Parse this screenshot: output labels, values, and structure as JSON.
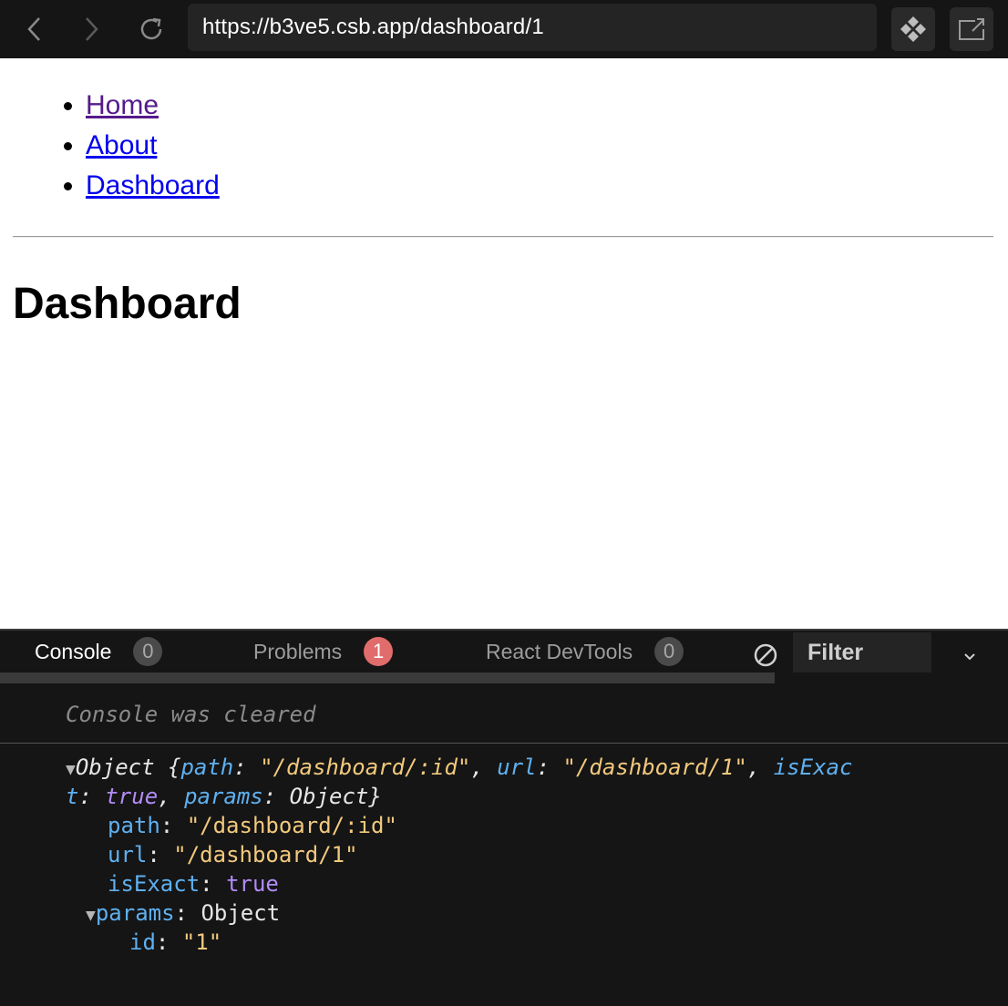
{
  "browser": {
    "url": "https://b3ve5.csb.app/dashboard/1",
    "back_icon": "chevron-left-icon",
    "forward_icon": "chevron-right-icon",
    "reload_icon": "reload-icon",
    "extension_icon": "diamond-grid-icon",
    "open_external_icon": "open-in-new-window-icon"
  },
  "page": {
    "nav_links": [
      {
        "label": "Home",
        "visited": true
      },
      {
        "label": "About",
        "visited": false
      },
      {
        "label": "Dashboard",
        "visited": false
      }
    ],
    "title": "Dashboard"
  },
  "console_panel": {
    "tabs": [
      {
        "label": "Console",
        "count": "0",
        "active": true
      },
      {
        "label": "Problems",
        "count": "1",
        "active": false
      },
      {
        "label": "React DevTools",
        "count": "0",
        "active": false
      }
    ],
    "filter_placeholder": "Filter",
    "cleared_message": "Console was cleared",
    "log": {
      "summary": {
        "type": "Object",
        "path_key": "path",
        "path_value": "\"/dashboard/:id\"",
        "url_key": "url",
        "url_value": "\"/dashboard/1\"",
        "isExact_key_part1": "isExac",
        "isExact_key_part2": "t",
        "isExact_value": "true",
        "params_key": "params",
        "params_value": "Object"
      },
      "props": {
        "path_key": "path",
        "path_value": "\"/dashboard/:id\"",
        "url_key": "url",
        "url_value": "\"/dashboard/1\"",
        "isExact_key": "isExact",
        "isExact_value": "true",
        "params_key": "params",
        "params_value": "Object",
        "id_key": "id",
        "id_value": "\"1\""
      }
    }
  },
  "colors": {
    "toolbar_bg": "#151515",
    "console_bg": "#151515",
    "key_blue": "#5fb0f0",
    "string_yellow": "#f2c97d",
    "boolean_purple": "#b18cf6",
    "badge_red": "#e06c6c"
  }
}
